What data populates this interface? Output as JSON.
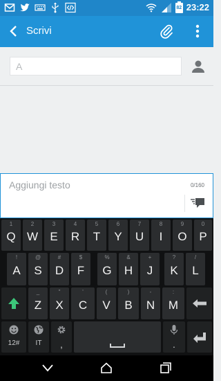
{
  "status_bar": {
    "time": "23:22",
    "battery_percent": 82,
    "battery_label": "82"
  },
  "action_bar": {
    "title": "Scrivi"
  },
  "recipient": {
    "placeholder": "A"
  },
  "compose": {
    "placeholder": "Aggiungi testo",
    "char_count": "0/160"
  },
  "keyboard": {
    "row1": [
      {
        "key": "Q",
        "hint": "1"
      },
      {
        "key": "W",
        "hint": "2"
      },
      {
        "key": "E",
        "hint": "3"
      },
      {
        "key": "R",
        "hint": "4"
      },
      {
        "key": "T",
        "hint": "5"
      },
      {
        "key": "Y",
        "hint": "6"
      },
      {
        "key": "U",
        "hint": "7"
      },
      {
        "key": "I",
        "hint": "8"
      },
      {
        "key": "O",
        "hint": "9"
      },
      {
        "key": "P",
        "hint": "0"
      }
    ],
    "row2": [
      {
        "key": "A",
        "hint": "!"
      },
      {
        "key": "S",
        "hint": "@"
      },
      {
        "key": "D",
        "hint": "#"
      },
      {
        "key": "F",
        "hint": "$"
      },
      {
        "key": "G",
        "hint": "%"
      },
      {
        "key": "H",
        "hint": "&"
      },
      {
        "key": "J",
        "hint": "+"
      },
      {
        "key": "K",
        "hint": "?"
      },
      {
        "key": "L",
        "hint": "/"
      }
    ],
    "row3": [
      {
        "key": "Z",
        "hint": "_"
      },
      {
        "key": "X",
        "hint": "\""
      },
      {
        "key": "C",
        "hint": "'"
      },
      {
        "key": "V",
        "hint": "("
      },
      {
        "key": "B",
        "hint": ")"
      },
      {
        "key": "N",
        "hint": "-"
      },
      {
        "key": "M",
        "hint": ":"
      }
    ],
    "bottom": {
      "numbers_label": "12#",
      "language_label": "IT",
      "comma": ",",
      "period": "."
    }
  },
  "icons": {
    "back": "arrow-left-icon",
    "attach": "paperclip-icon",
    "overflow": "overflow-menu-icon",
    "contact": "person-icon",
    "send": "comment-send-icon",
    "shift": "shift-arrow-icon",
    "backspace": "backspace-icon",
    "enter": "enter-icon",
    "emoji": "smiley-icon",
    "globe": "globe-icon",
    "settings": "gear-icon",
    "mic": "microphone-icon"
  },
  "colors": {
    "status_bar": "#1f86c9",
    "action_bar": "#2093d8",
    "compose_border": "#2093d8",
    "shift_arrow": "#3cc77a",
    "keyboard_bg": "#101112",
    "key_bg": "#2b2d2f"
  }
}
